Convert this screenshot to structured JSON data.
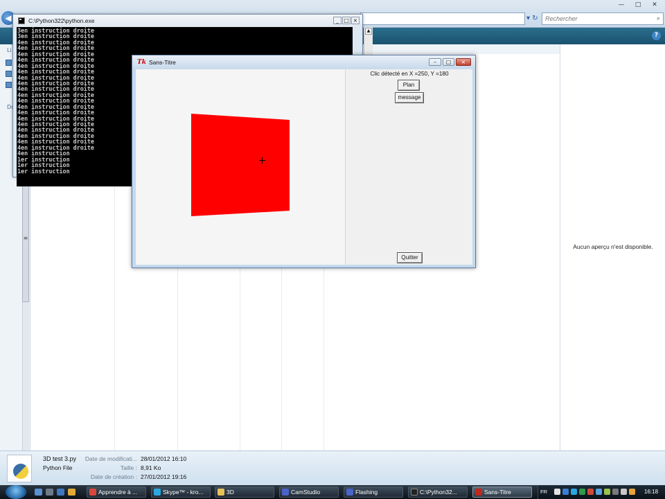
{
  "explorer": {
    "search_placeholder": "Rechercher",
    "left_labels": [
      "Li",
      "Do"
    ],
    "preview_text": "Aucun aperçu n'est disponible.",
    "help_glyph": "?"
  },
  "console": {
    "title": "C:\\Python322\\python.exe",
    "lines": [
      "3en instruction droite",
      "3en instruction droite",
      "4en instruction droite",
      "4en instruction droite",
      "4en instruction droite",
      "4en instruction droite",
      "4en instruction droite",
      "4en instruction droite",
      "4en instruction droite",
      "4en instruction droite",
      "4en instruction droite",
      "4en instruction droite",
      "4en instruction droite",
      "4en instruction droite",
      "4en instruction droite",
      "4en instruction droite",
      "4en instruction droite",
      "4en instruction droite",
      "4en instruction droite",
      "4en instruction droite",
      "4en instruction droite",
      "4en instruction",
      "1er instruction",
      "1er instruction",
      "1er instruction"
    ],
    "buttons": [
      "_",
      "□",
      "×"
    ]
  },
  "tk_window": {
    "title": "Sans-Titre",
    "icon_text": "Tk",
    "click_label": "Clic détecté en X =250, Y =180",
    "buttons": {
      "plan": "Plan",
      "message": "message",
      "quitter": "Quitter"
    },
    "square_color": "#ff0000",
    "title_buttons": [
      "–",
      "□",
      "×"
    ]
  },
  "details": {
    "file_name": "3D test 3.py",
    "file_type": "Python File",
    "modified_label": "Date de modificati...",
    "modified_value": "28/01/2012 16:10",
    "size_label": "Taille :",
    "size_value": "8,91 Ko",
    "created_label": "Date de création :",
    "created_value": "27/01/2012 19:16"
  },
  "taskbar": {
    "items": [
      {
        "label": "Apprendre à ...",
        "icon_color": "#d9483b"
      },
      {
        "label": "Skype™ - kro...",
        "icon_color": "#2aa7e0"
      },
      {
        "label": "3D",
        "icon_color": "#e8c25a"
      },
      {
        "label": "CamStudio",
        "icon_color": "#4a63c9"
      },
      {
        "label": "Flashing",
        "icon_color": "#4a63c9"
      },
      {
        "label": "C:\\Python32...",
        "icon_color": "#222222"
      },
      {
        "label": "Sans-Titre",
        "icon_color": "#c0281c"
      }
    ],
    "lang": "FR",
    "clock": "16:18"
  }
}
